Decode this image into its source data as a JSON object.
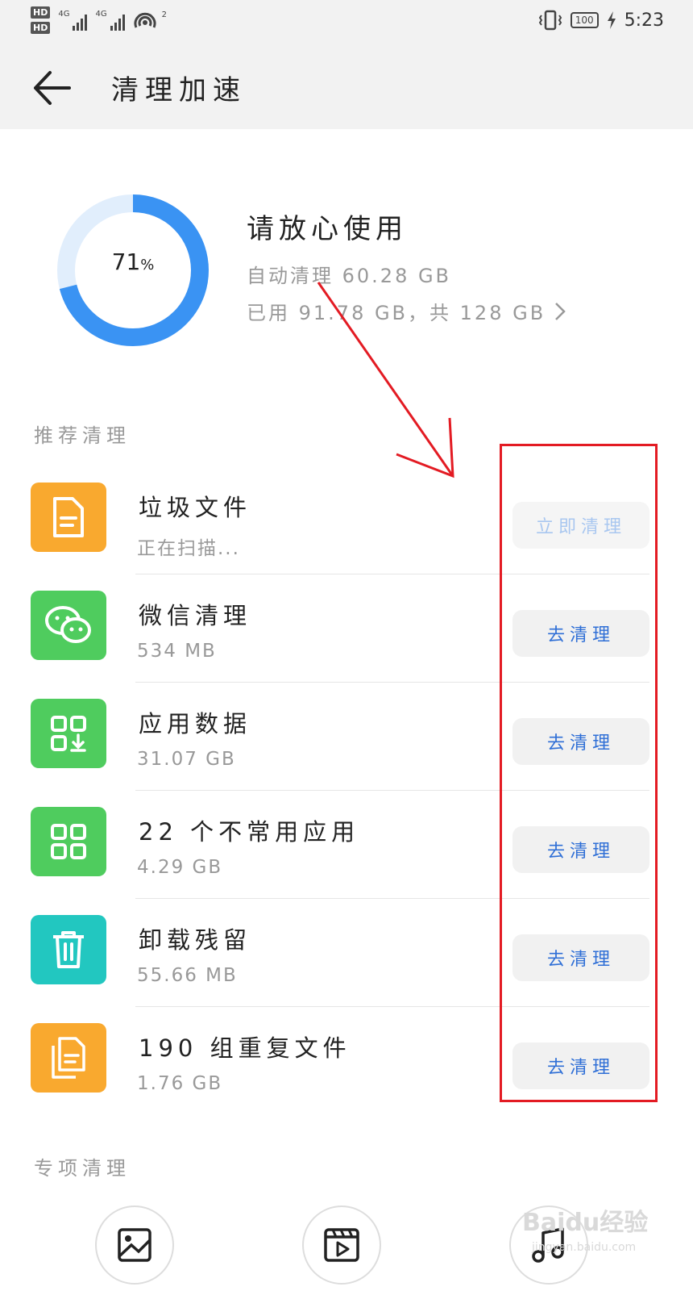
{
  "status_bar": {
    "hd1": "HD",
    "hd2": "HD",
    "net1": "4G",
    "net2": "4G",
    "hotspot_badge": "2",
    "battery": "100",
    "time": "5:23"
  },
  "header": {
    "title": "清理加速"
  },
  "storage": {
    "percent": "71",
    "percent_unit": "%",
    "percent_value": 0.71,
    "status": "请放心使用",
    "auto_clean": "自动清理 60.28 GB",
    "usage": "已用 91.78 GB，共 128 GB"
  },
  "recommended": {
    "label": "推荐清理",
    "items": [
      {
        "title": "垃圾文件",
        "subtitle": "正在扫描...",
        "button": "立即清理",
        "icon": "document-icon",
        "color": "#f9a92f"
      },
      {
        "title": "微信清理",
        "subtitle": "534 MB",
        "button": "去清理",
        "icon": "wechat-icon",
        "color": "#4fcc5e"
      },
      {
        "title": "应用数据",
        "subtitle": "31.07 GB",
        "button": "去清理",
        "icon": "app-data-icon",
        "color": "#4fcc5e"
      },
      {
        "title": "22 个不常用应用",
        "subtitle": "4.29 GB",
        "button": "去清理",
        "icon": "apps-grid-icon",
        "color": "#4fcc5e"
      },
      {
        "title": "卸载残留",
        "subtitle": "55.66 MB",
        "button": "去清理",
        "icon": "trash-icon",
        "color": "#22c7c0"
      },
      {
        "title": "190 组重复文件",
        "subtitle": "1.76 GB",
        "button": "去清理",
        "icon": "duplicate-file-icon",
        "color": "#f9a92f"
      }
    ]
  },
  "special": {
    "label": "专项清理",
    "icons": [
      "image-icon",
      "video-icon",
      "music-icon"
    ]
  },
  "watermark": {
    "brand": "Baidu经验",
    "url": "jingyan.baidu.com"
  }
}
